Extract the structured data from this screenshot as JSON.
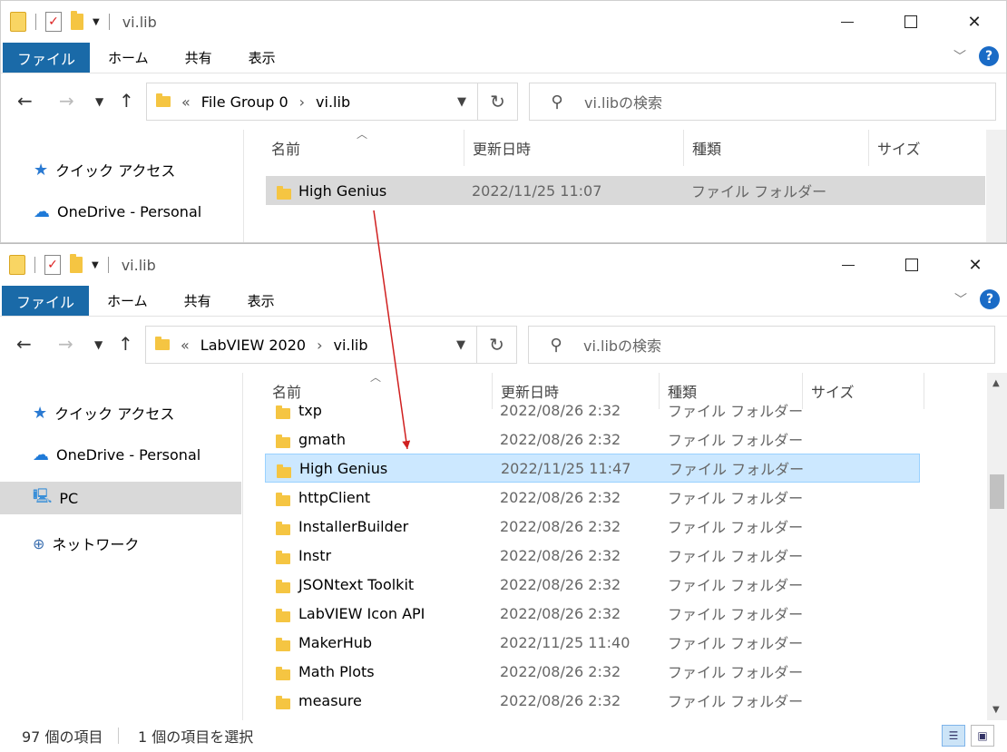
{
  "colors": {
    "file_tab": "#1a6aa8",
    "selection": "#cce8ff",
    "selection_border": "#99d1ff",
    "highlight_gray": "#d9d9d9",
    "arrow": "#d02020"
  },
  "window1": {
    "title": "vi.lib",
    "ribbon": {
      "file": "ファイル",
      "home": "ホーム",
      "share": "共有",
      "view": "表示"
    },
    "path": [
      "File Group 0",
      "vi.lib"
    ],
    "path_prefix": "«",
    "search_placeholder": "vi.libの検索",
    "columns": {
      "name": "名前",
      "date": "更新日時",
      "type": "種類",
      "size": "サイズ"
    },
    "sidebar": {
      "quick_access": "クイック アクセス",
      "onedrive": "OneDrive - Personal"
    },
    "rows": [
      {
        "name": "High Genius",
        "date": "2022/11/25 11:07",
        "type": "ファイル フォルダー"
      }
    ]
  },
  "window2": {
    "title": "vi.lib",
    "ribbon": {
      "file": "ファイル",
      "home": "ホーム",
      "share": "共有",
      "view": "表示"
    },
    "path": [
      "LabVIEW 2020",
      "vi.lib"
    ],
    "path_prefix": "«",
    "search_placeholder": "vi.libの検索",
    "columns": {
      "name": "名前",
      "date": "更新日時",
      "type": "種類",
      "size": "サイズ"
    },
    "sidebar": {
      "quick_access": "クイック アクセス",
      "onedrive": "OneDrive - Personal",
      "pc": "PC",
      "network": "ネットワーク"
    },
    "rows": [
      {
        "name": "txp",
        "date": "2022/08/26 2:32",
        "type": "ファイル フォルダー"
      },
      {
        "name": "gmath",
        "date": "2022/08/26 2:32",
        "type": "ファイル フォルダー"
      },
      {
        "name": "High Genius",
        "date": "2022/11/25 11:47",
        "type": "ファイル フォルダー"
      },
      {
        "name": "httpClient",
        "date": "2022/08/26 2:32",
        "type": "ファイル フォルダー"
      },
      {
        "name": "InstallerBuilder",
        "date": "2022/08/26 2:32",
        "type": "ファイル フォルダー"
      },
      {
        "name": "Instr",
        "date": "2022/08/26 2:32",
        "type": "ファイル フォルダー"
      },
      {
        "name": "JSONtext Toolkit",
        "date": "2022/08/26 2:32",
        "type": "ファイル フォルダー"
      },
      {
        "name": "LabVIEW Icon API",
        "date": "2022/08/26 2:32",
        "type": "ファイル フォルダー"
      },
      {
        "name": "MakerHub",
        "date": "2022/11/25 11:40",
        "type": "ファイル フォルダー"
      },
      {
        "name": "Math Plots",
        "date": "2022/08/26 2:32",
        "type": "ファイル フォルダー"
      },
      {
        "name": "measure",
        "date": "2022/08/26 2:32",
        "type": "ファイル フォルダー"
      }
    ],
    "status": {
      "count": "97 個の項目",
      "selected": "1 個の項目を選択"
    }
  },
  "icons": [
    "folder-icon",
    "notes-icon",
    "star-icon",
    "cloud-icon",
    "pc-icon",
    "network-icon",
    "search-icon",
    "refresh-icon",
    "help-icon",
    "details-view-icon",
    "large-icons-view-icon"
  ]
}
